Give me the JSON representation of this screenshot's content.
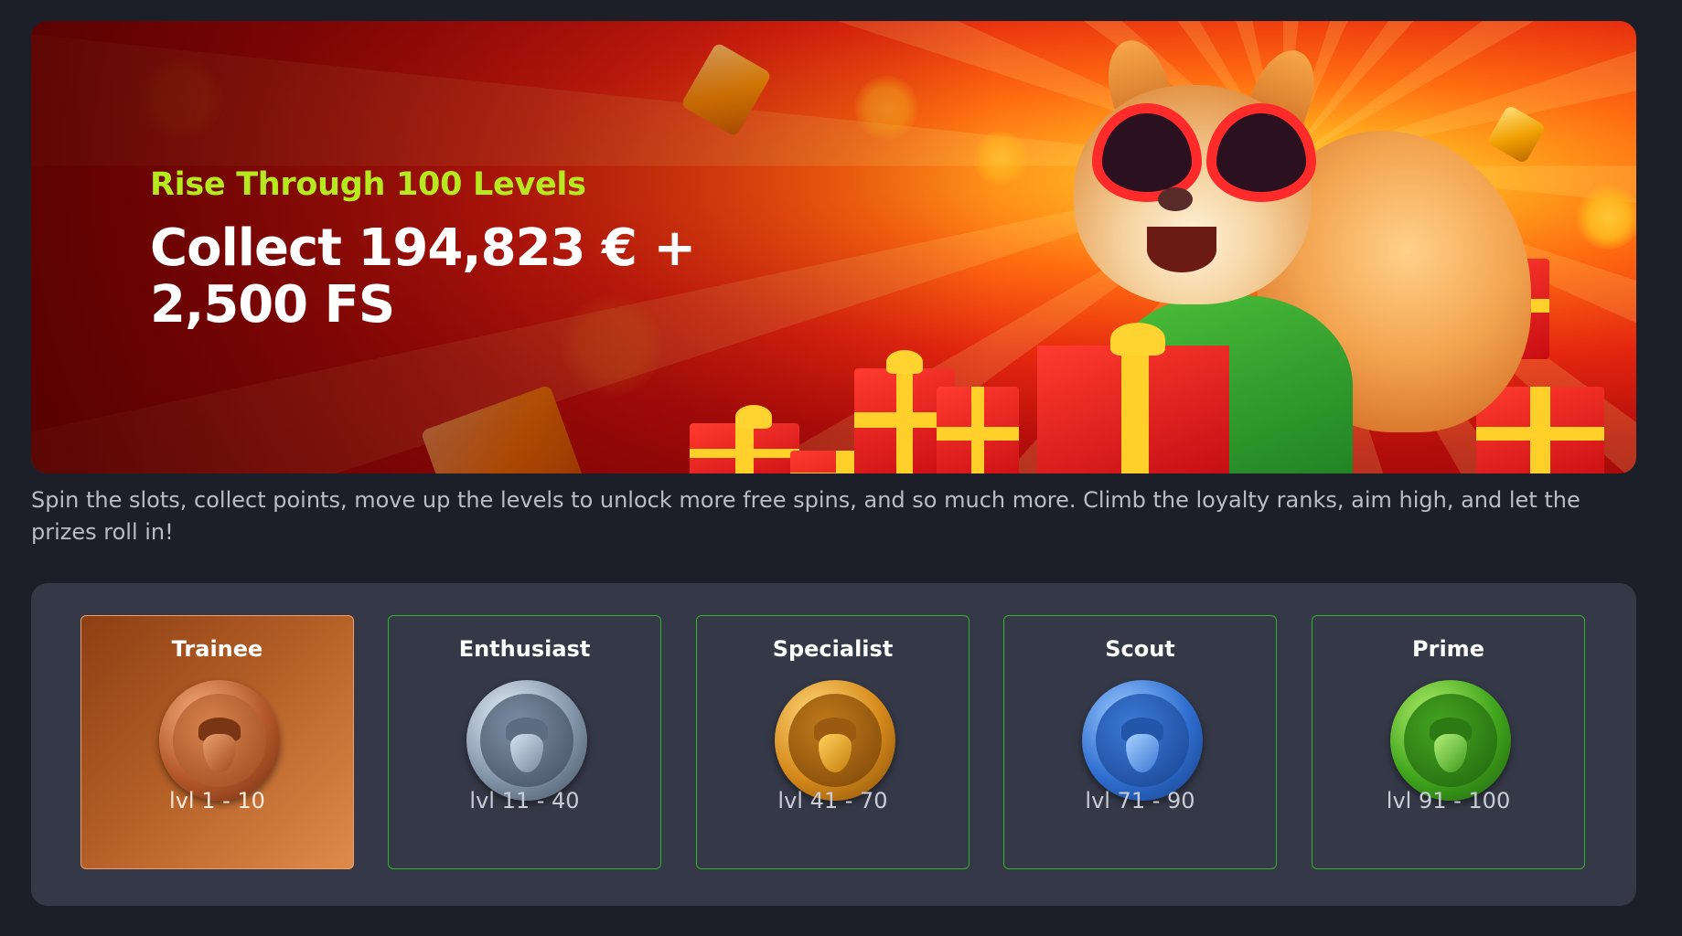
{
  "banner": {
    "subtitle": "Rise Through 100 Levels",
    "title": "Collect 194,823 € + 2,500 FS"
  },
  "description": "Spin the slots, collect points, move up the levels to unlock more free spins, and so much more. Climb the loyalty ranks, aim high, and let the prizes roll in!",
  "tiers": [
    {
      "name": "Trainee",
      "levels": "lvl 1 - 10",
      "icon": "bronze-acorn-medal-icon",
      "active": true
    },
    {
      "name": "Enthusiast",
      "levels": "lvl 11 - 40",
      "icon": "silver-acorn-medal-icon",
      "active": false
    },
    {
      "name": "Specialist",
      "levels": "lvl 41 - 70",
      "icon": "gold-acorn-medal-icon",
      "active": false
    },
    {
      "name": "Scout",
      "levels": "lvl 71 - 90",
      "icon": "blue-acorn-medal-icon",
      "active": false
    },
    {
      "name": "Prime",
      "levels": "lvl 91 - 100",
      "icon": "green-acorn-medal-icon",
      "active": false
    }
  ],
  "colors": {
    "page_background": "#1c1f28",
    "panel_background": "#353847",
    "subtitle_accent": "#b6ea20",
    "tier_border": "#2fb12a",
    "active_tier": "#b25d25"
  }
}
